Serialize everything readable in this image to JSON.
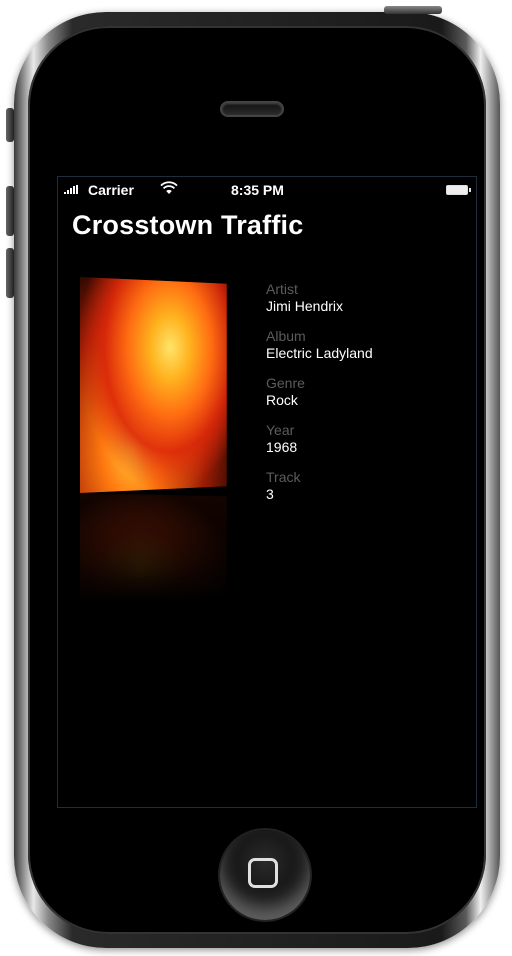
{
  "status_bar": {
    "carrier": "Carrier",
    "time": "8:35 PM"
  },
  "song": {
    "title": "Crosstown Traffic"
  },
  "details": [
    {
      "label": "Artist",
      "value": "Jimi Hendrix"
    },
    {
      "label": "Album",
      "value": "Electric Ladyland"
    },
    {
      "label": "Genre",
      "value": "Rock"
    },
    {
      "label": "Year",
      "value": "1968"
    },
    {
      "label": "Track",
      "value": "3"
    }
  ],
  "icons": {
    "signal": "signal-bars-icon",
    "wifi": "wifi-icon",
    "battery": "battery-icon",
    "home": "home-button-icon"
  },
  "colors": {
    "background": "#000000",
    "label": "#5c5c5c",
    "value": "#ffffff"
  }
}
